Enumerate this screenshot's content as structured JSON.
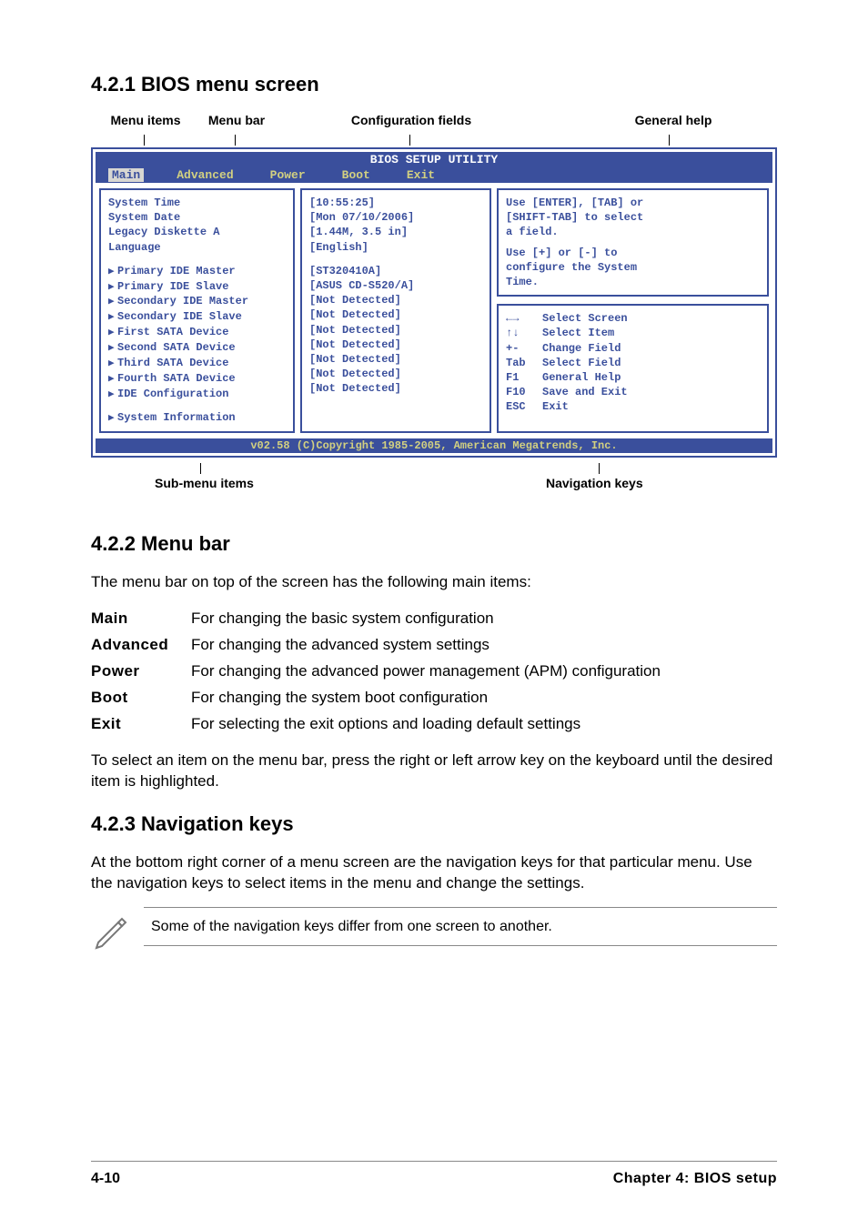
{
  "sections": {
    "s421": "4.2.1   BIOS menu screen",
    "s422": "4.2.2   Menu bar",
    "s423": "4.2.3   Navigation keys"
  },
  "callouts": {
    "menu_items": "Menu items",
    "menu_bar": "Menu bar",
    "config_fields": "Configuration fields",
    "general_help": "General help",
    "submenu_items": "Sub-menu items",
    "nav_keys": "Navigation keys"
  },
  "bios": {
    "title": "BIOS SETUP UTILITY",
    "menubar": {
      "main": "Main",
      "advanced": "Advanced",
      "power": "Power",
      "boot": "Boot",
      "exit": "Exit"
    },
    "left": {
      "system_time": "System Time",
      "system_date": "System Date",
      "legacy_diskette": "Legacy Diskette A",
      "language": "Language",
      "primary_ide_master": "Primary IDE Master",
      "primary_ide_slave": "Primary IDE Slave",
      "secondary_ide_master": "Secondary IDE Master",
      "secondary_ide_slave": "Secondary IDE Slave",
      "first_sata": "First SATA Device",
      "second_sata": "Second SATA Device",
      "third_sata": "Third SATA Device",
      "fourth_sata": "Fourth SATA Device",
      "ide_config": "IDE Configuration",
      "system_info": "System Information"
    },
    "mid": {
      "time": "[10:55:25]",
      "date": "[Mon 07/10/2006]",
      "diskette": "[1.44M, 3.5 in]",
      "lang": "[English]",
      "pim": "[ST320410A]",
      "pis": "[ASUS CD-S520/A]",
      "nd1": "[Not Detected]",
      "nd2": "[Not Detected]",
      "nd3": "[Not Detected]",
      "nd4": "[Not Detected]",
      "nd5": "[Not Detected]",
      "nd6": "[Not Detected]",
      "nd7": "[Not Detected]"
    },
    "help_top": {
      "l1": "Use [ENTER], [TAB] or",
      "l2": "[SHIFT-TAB] to select",
      "l3": "a field.",
      "l4": "Use [+] or [-] to",
      "l5": "configure the System",
      "l6": "Time."
    },
    "nav": {
      "k1": "←→",
      "v1": "Select Screen",
      "k2": "↑↓",
      "v2": "Select Item",
      "k3": "+-",
      "v3": "Change Field",
      "k4": "Tab",
      "v4": "Select Field",
      "k5": "F1",
      "v5": "General Help",
      "k6": "F10",
      "v6": "Save and Exit",
      "k7": "ESC",
      "v7": "Exit"
    },
    "footer": "v02.58 (C)Copyright 1985-2005, American Megatrends, Inc."
  },
  "body": {
    "p422_intro": "The menu bar on top of the screen has the following main items:",
    "defs": {
      "main_t": "Main",
      "main_d": "For changing the basic system configuration",
      "adv_t": "Advanced",
      "adv_d": "For changing the advanced system settings",
      "pow_t": "Power",
      "pow_d": "For changing the advanced power management (APM) configuration",
      "boot_t": "Boot",
      "boot_d": "For changing the system boot configuration",
      "exit_t": "Exit",
      "exit_d": "For selecting the exit options and loading default settings"
    },
    "p422_end": "To select an item on the menu bar, press the right or left arrow key on the keyboard until the desired item is highlighted.",
    "p423": "At the bottom right corner of a menu screen are the navigation keys for that particular menu. Use the navigation keys to select items in the menu and change the settings.",
    "note": "Some of the navigation keys differ from one screen to another."
  },
  "footer": {
    "page": "4-10",
    "chapter": "Chapter 4: BIOS setup"
  }
}
